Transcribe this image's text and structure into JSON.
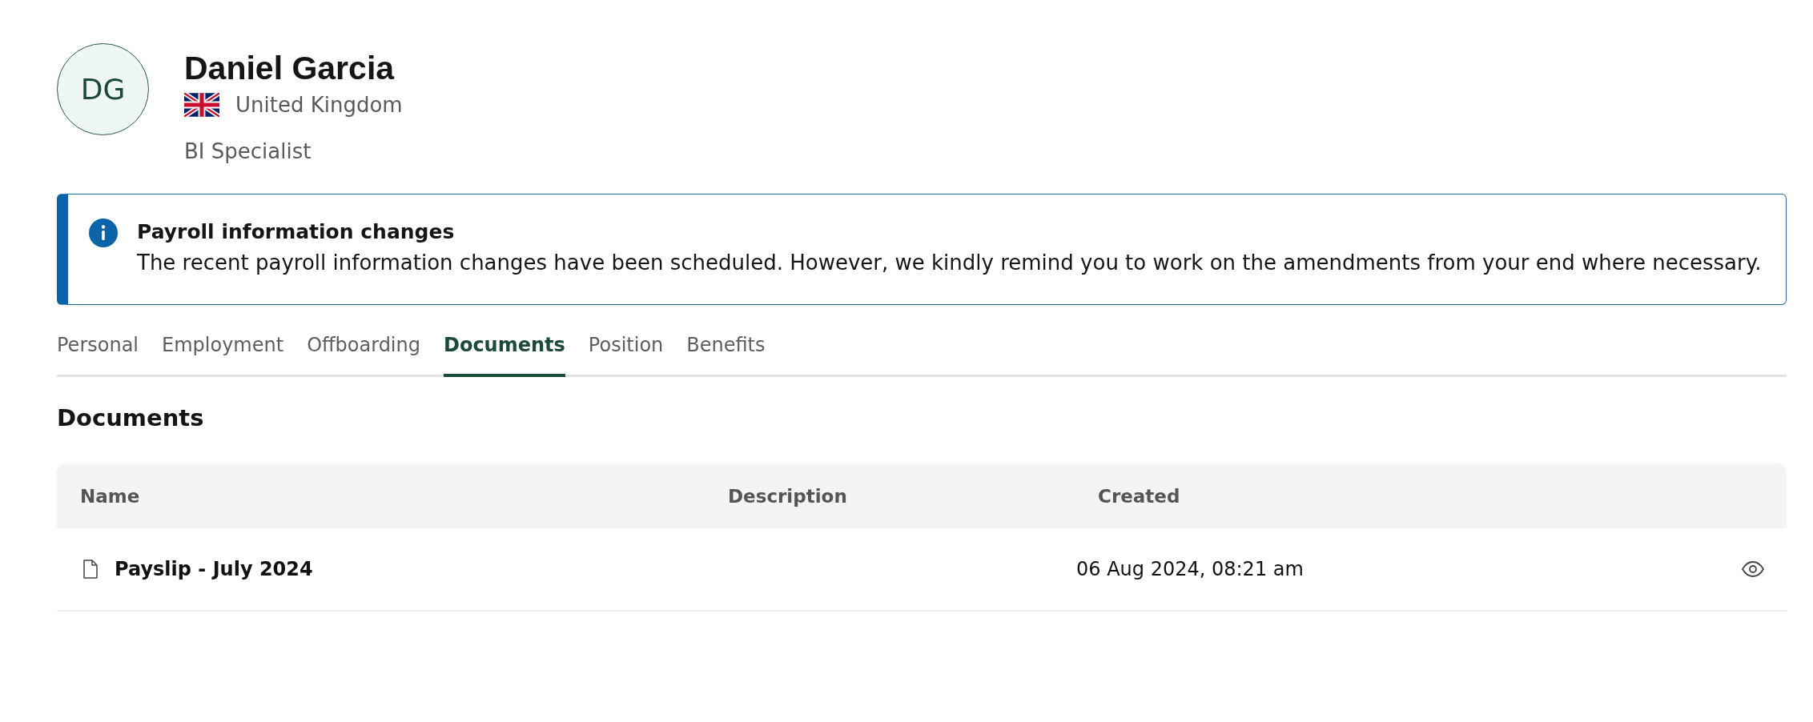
{
  "profile": {
    "initials": "DG",
    "name": "Daniel Garcia",
    "country": "United Kingdom",
    "job_title": "BI Specialist"
  },
  "alert": {
    "title": "Payroll information changes",
    "message": "The recent payroll information changes have been scheduled. However, we kindly remind you to work on the amendments from your end where necessary."
  },
  "tabs": [
    {
      "label": "Personal",
      "selected": false
    },
    {
      "label": "Employment",
      "selected": false
    },
    {
      "label": "Offboarding",
      "selected": false
    },
    {
      "label": "Documents",
      "selected": true
    },
    {
      "label": "Position",
      "selected": false
    },
    {
      "label": "Benefits",
      "selected": false
    }
  ],
  "section_title": "Documents",
  "table": {
    "columns": [
      "Name",
      "Description",
      "Created"
    ],
    "rows": [
      {
        "name": "Payslip - July 2024",
        "created": "06 Aug 2024, 08:21 am"
      }
    ]
  }
}
